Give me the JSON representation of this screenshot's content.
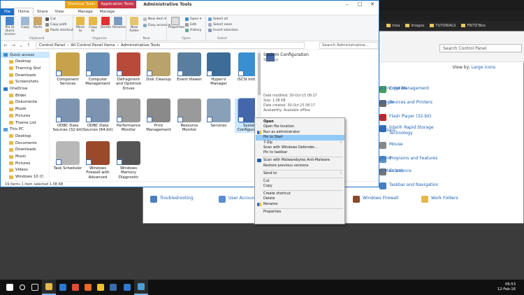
{
  "colors": {
    "accent": "#1e6fc2",
    "shortcut_tools_tab": "#e8a317",
    "application_tools_tab": "#c9344c",
    "menu_highlight": "#91c9f7",
    "taskbar": "#101010"
  },
  "browser": {
    "bookmarks": [
      "moa",
      "Images",
      "TUTORIALS",
      "FRITZ!Box"
    ]
  },
  "control_panel": {
    "search_placeholder": "Search Control Panel",
    "view_by_label": "View by:",
    "view_by_value": "Large icons",
    "items_right": [
      "Color Management",
      "Devices and Printers",
      "Flash Player (32-bit)",
      "Intel® Rapid Storage Technology",
      "Mouse",
      "Programs and Features",
      "Sound",
      "Taskbar and Navigation",
      "Work Folders"
    ],
    "items_mid": [
      "rive Encryption",
      "Manager",
      "tory",
      "g Options",
      "Options",
      "Options",
      "and Maintenance",
      "Windows Firewall"
    ],
    "items_bottom": [
      "Troubleshooting",
      "User Accounts"
    ]
  },
  "explorer": {
    "tab_shortcut_tools": "Shortcut Tools",
    "tab_application_tools": "Application Tools",
    "title": "Administrative Tools",
    "tabs": [
      "File",
      "Home",
      "Share",
      "View",
      "Manage",
      "Manage"
    ],
    "ribbon": {
      "clipboard": {
        "label": "Clipboard",
        "pin": "Pin to Quick access",
        "copy": "Copy",
        "paste": "Paste",
        "cut": "Cut",
        "copy_path": "Copy path",
        "paste_shortcut": "Paste shortcut"
      },
      "organize": {
        "label": "Organize",
        "move_to": "Move to",
        "copy_to": "Copy to",
        "delete": "Delete",
        "rename": "Rename"
      },
      "new": {
        "label": "New",
        "new_folder": "New folder",
        "new_item": "New item ▾",
        "easy_access": "Easy access ▾"
      },
      "open": {
        "label": "Open",
        "properties": "Properties",
        "open": "Open ▾",
        "edit": "Edit",
        "history": "History"
      },
      "select": {
        "label": "Select",
        "select_all": "Select all",
        "select_none": "Select none",
        "invert": "Invert selection"
      }
    },
    "address": [
      "Control Panel",
      "All Control Panel Items",
      "Administrative Tools"
    ],
    "search_placeholder": "Search Administrative...",
    "nav": [
      {
        "label": "Quick access",
        "level": 0,
        "selected": true
      },
      {
        "label": "Desktop",
        "level": 1
      },
      {
        "label": "Theming Stuf",
        "level": 1
      },
      {
        "label": "Downloads",
        "level": 1
      },
      {
        "label": "Screenshots",
        "level": 1
      },
      {
        "label": "OneDrive",
        "level": 0
      },
      {
        "label": "Bilder",
        "level": 1
      },
      {
        "label": "Dokumente",
        "level": 1
      },
      {
        "label": "Musik",
        "level": 1
      },
      {
        "label": "Pictures",
        "level": 1
      },
      {
        "label": "Theme List",
        "level": 1
      },
      {
        "label": "This PC",
        "level": 0
      },
      {
        "label": "Desktop",
        "level": 1
      },
      {
        "label": "Documents",
        "level": 1
      },
      {
        "label": "Downloads",
        "level": 1
      },
      {
        "label": "Music",
        "level": 1
      },
      {
        "label": "Pictures",
        "level": 1
      },
      {
        "label": "Videos",
        "level": 1
      },
      {
        "label": "Windows 10 (C:",
        "level": 1
      }
    ],
    "items": [
      {
        "label": "Component Services",
        "color": "#c8a24a"
      },
      {
        "label": "Computer Management",
        "color": "#6a8fb5"
      },
      {
        "label": "Defragment and Optimize Drives",
        "color": "#b84a3a"
      },
      {
        "label": "Disk Cleanup",
        "color": "#b9a36a"
      },
      {
        "label": "Event Viewer",
        "color": "#5a7f9e"
      },
      {
        "label": "Hyper-V Manager",
        "color": "#3d6c98"
      },
      {
        "label": "iSCSI Initiator",
        "color": "#3a8fd1"
      },
      {
        "label": "Local Security Policy",
        "color": "#7d6a4a"
      },
      {
        "label": "ODBC Data Sources (32-bit)",
        "color": "#7c94b0"
      },
      {
        "label": "ODBC Data Sources (64-bit)",
        "color": "#7c94b0"
      },
      {
        "label": "Performance Monitor",
        "color": "#9a9a9a"
      },
      {
        "label": "Print Management",
        "color": "#8a8a8a"
      },
      {
        "label": "Resource Monitor",
        "color": "#9a9a9a"
      },
      {
        "label": "Services",
        "color": "#8aa0b8"
      },
      {
        "label": "System Configuration",
        "color": "#4466aa",
        "selected": true
      },
      {
        "label": "",
        "color": "#2e6bb8"
      },
      {
        "label": "Task Scheduler",
        "color": "#b8b8b8"
      },
      {
        "label": "Windows Firewall with Advanced",
        "color": "#9a4a2a"
      },
      {
        "label": "Windows Memory Diagnostic",
        "color": "#555555"
      }
    ],
    "preview": {
      "title": "System Configuration",
      "type": "Shortcut",
      "rows": [
        {
          "k": "Date modified:",
          "v": "30-Oct-15 08:17"
        },
        {
          "k": "Size:",
          "v": "1.08 KB"
        },
        {
          "k": "Date created:",
          "v": "30-Oct-15 08:17"
        },
        {
          "k": "Availability:",
          "v": "Available offline"
        }
      ]
    },
    "status": "19 items    1 item selected  1.08 KB"
  },
  "context_menu": [
    {
      "label": "Open",
      "bold": true
    },
    {
      "label": "Open file location"
    },
    {
      "label": "Run as administrator",
      "icon": "shield"
    },
    {
      "label": "Pin to Start",
      "highlight": true
    },
    {
      "label": "7-Zip",
      "submenu": true
    },
    {
      "label": "Scan with Windows Defender..."
    },
    {
      "label": "Pin to taskbar"
    },
    {
      "sep": true
    },
    {
      "label": "Scan with Malwarebytes Anti-Malware",
      "icon": "mb"
    },
    {
      "label": "Restore previous versions"
    },
    {
      "sep": true
    },
    {
      "label": "Send to",
      "submenu": true
    },
    {
      "sep": true
    },
    {
      "label": "Cut"
    },
    {
      "label": "Copy"
    },
    {
      "sep": true
    },
    {
      "label": "Create shortcut"
    },
    {
      "label": "Delete"
    },
    {
      "label": "Rename",
      "icon": "shield"
    },
    {
      "sep": true
    },
    {
      "label": "Properties"
    }
  ],
  "taskbar": {
    "icons": [
      "start-icon",
      "search-icon",
      "task-view-icon",
      "file-explorer-icon",
      "edge-icon",
      "chrome-icon",
      "firefox-icon",
      "chrome-icon",
      "windows-defender-icon",
      "store-icon",
      "control-panel-icon"
    ],
    "time": "06:53",
    "date": "12-Feb-16"
  }
}
